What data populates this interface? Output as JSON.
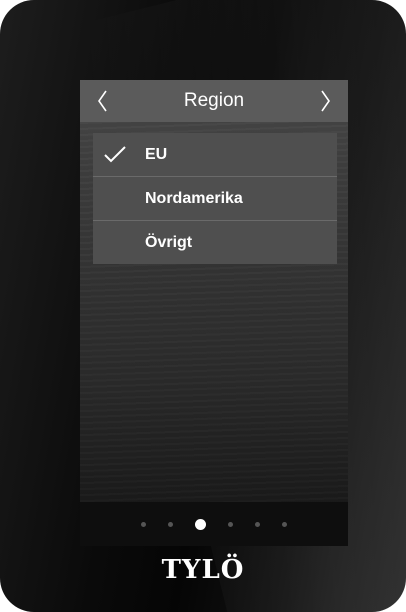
{
  "header": {
    "title": "Region",
    "prev_icon": "chevron-left-icon",
    "next_icon": "chevron-right-icon"
  },
  "region_list": {
    "items": [
      {
        "label": "EU",
        "selected": true
      },
      {
        "label": "Nordamerika",
        "selected": false
      },
      {
        "label": "Övrigt",
        "selected": false
      }
    ],
    "check_icon": "checkmark-icon"
  },
  "pagination": {
    "total_pages": 6,
    "current_page": 3
  },
  "brand": {
    "logo_text": "TYLÖ"
  },
  "colors": {
    "header_bg": "#5b5b5b",
    "list_bg": "#4f4f4f",
    "text": "#ffffff",
    "active_dot": "#ffffff",
    "inactive_dot": "#555555"
  }
}
